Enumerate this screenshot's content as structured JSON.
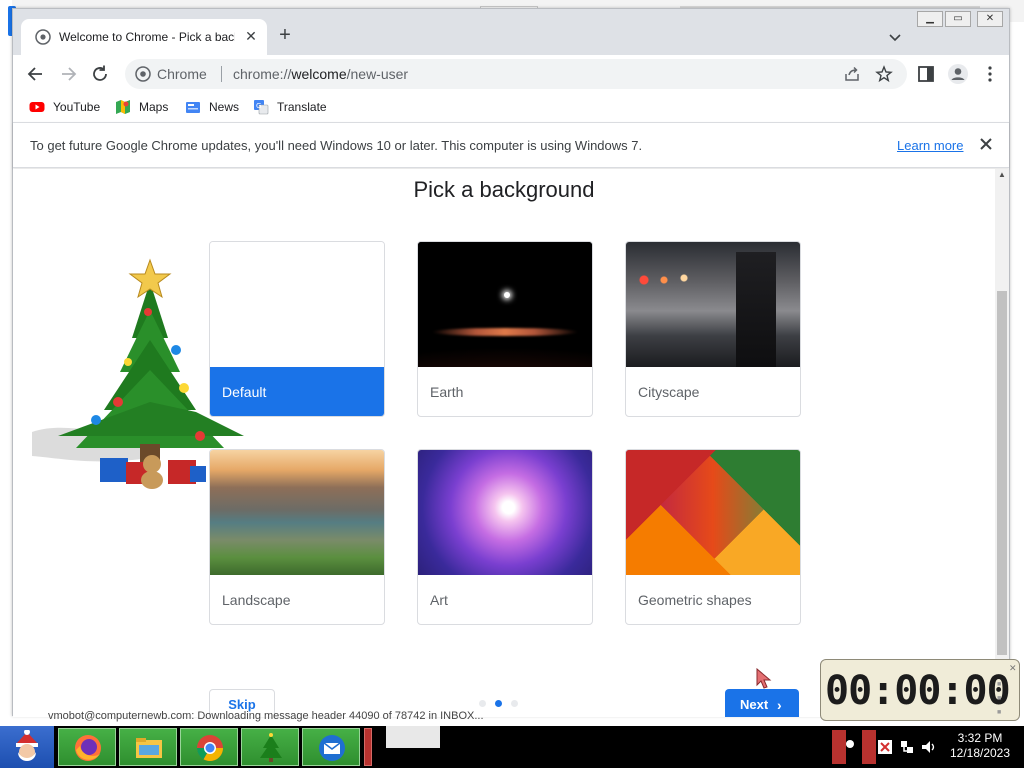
{
  "browser": {
    "tab": {
      "title": "Welcome to Chrome - Pick a background"
    },
    "omnibox": {
      "chip": "Chrome",
      "url_prefix": "chrome://",
      "url_host": "welcome",
      "url_path": "/new-user"
    },
    "bookmarks": [
      {
        "label": "YouTube",
        "icon": "youtube-icon"
      },
      {
        "label": "Maps",
        "icon": "maps-icon"
      },
      {
        "label": "News",
        "icon": "news-icon"
      },
      {
        "label": "Translate",
        "icon": "translate-icon"
      }
    ],
    "infobar": {
      "message": "To get future Google Chrome updates, you'll need Windows 10 or later. This computer is using Windows 7.",
      "link": "Learn more"
    }
  },
  "page": {
    "title": "Pick a background",
    "backgrounds": [
      {
        "label": "Default",
        "selected": true
      },
      {
        "label": "Earth",
        "selected": false
      },
      {
        "label": "Cityscape",
        "selected": false
      },
      {
        "label": "Landscape",
        "selected": false
      },
      {
        "label": "Art",
        "selected": false
      },
      {
        "label": "Geometric shapes",
        "selected": false
      }
    ],
    "skip_label": "Skip",
    "next_label": "Next",
    "step": {
      "current": 2,
      "total": 3
    }
  },
  "status_bar": {
    "text": "vmobot@computernewb.com: Downloading message header 44090 of 78742 in INBOX..."
  },
  "timer": {
    "display": "00:00:00"
  },
  "taskbar": {
    "clock_time": "3:32 PM",
    "clock_date": "12/18/2023"
  },
  "colors": {
    "accent": "#1a73e8",
    "taskbar_green": "#3fa63f",
    "taskbar_red": "#b8322f"
  }
}
